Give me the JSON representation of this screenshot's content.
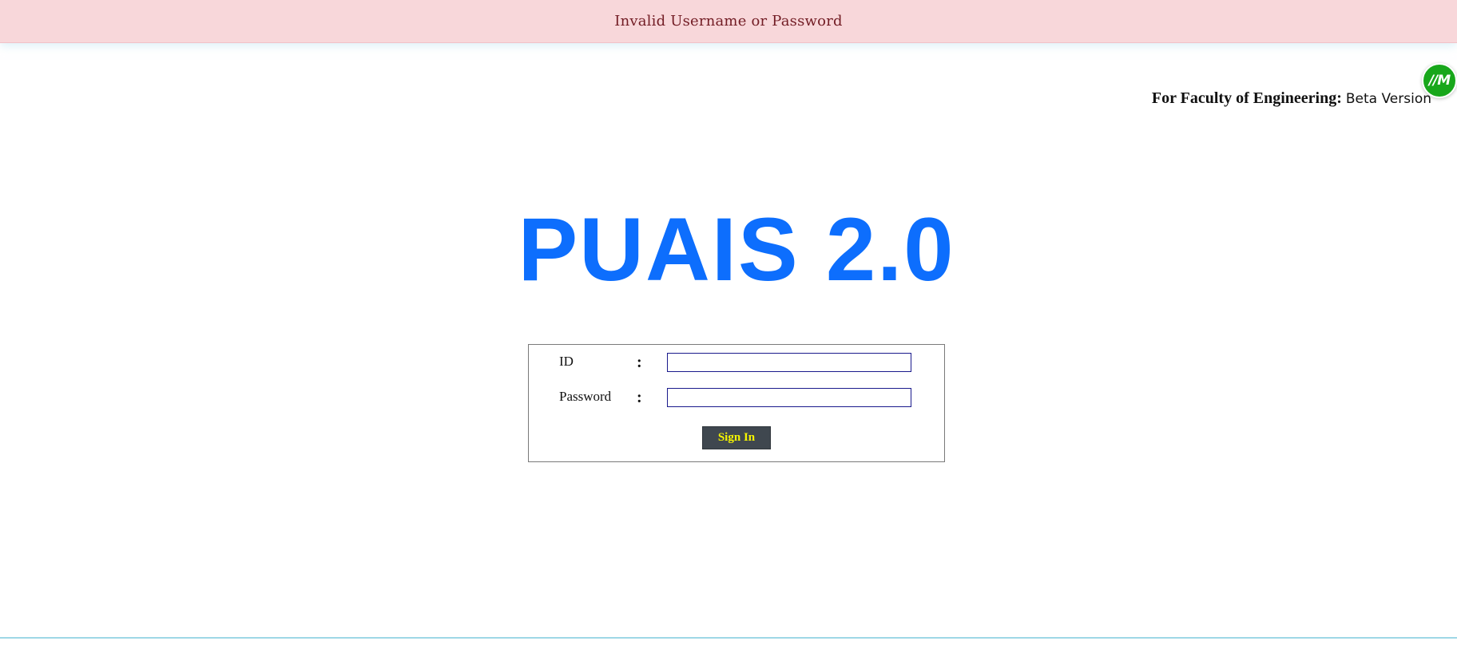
{
  "alert": {
    "message": "Invalid Username or Password"
  },
  "widget": {
    "label": "//M",
    "icon": "chat-widget-icon"
  },
  "faculty": {
    "label": "For Faculty of Engineering:",
    "version": "Beta Version"
  },
  "app": {
    "title": "PUAIS 2.0",
    "title_color": "#0d6efd"
  },
  "login": {
    "id_label": "ID",
    "id_colon": ":",
    "id_value": "",
    "password_label": "Password",
    "password_colon": ":",
    "password_value": "",
    "submit_label": "Sign In"
  },
  "colors": {
    "alert_bg": "#f8d7da",
    "alert_text": "#721c24",
    "button_bg": "#3f474f",
    "button_text": "#f5f500",
    "widget_bg": "#18a71b"
  }
}
